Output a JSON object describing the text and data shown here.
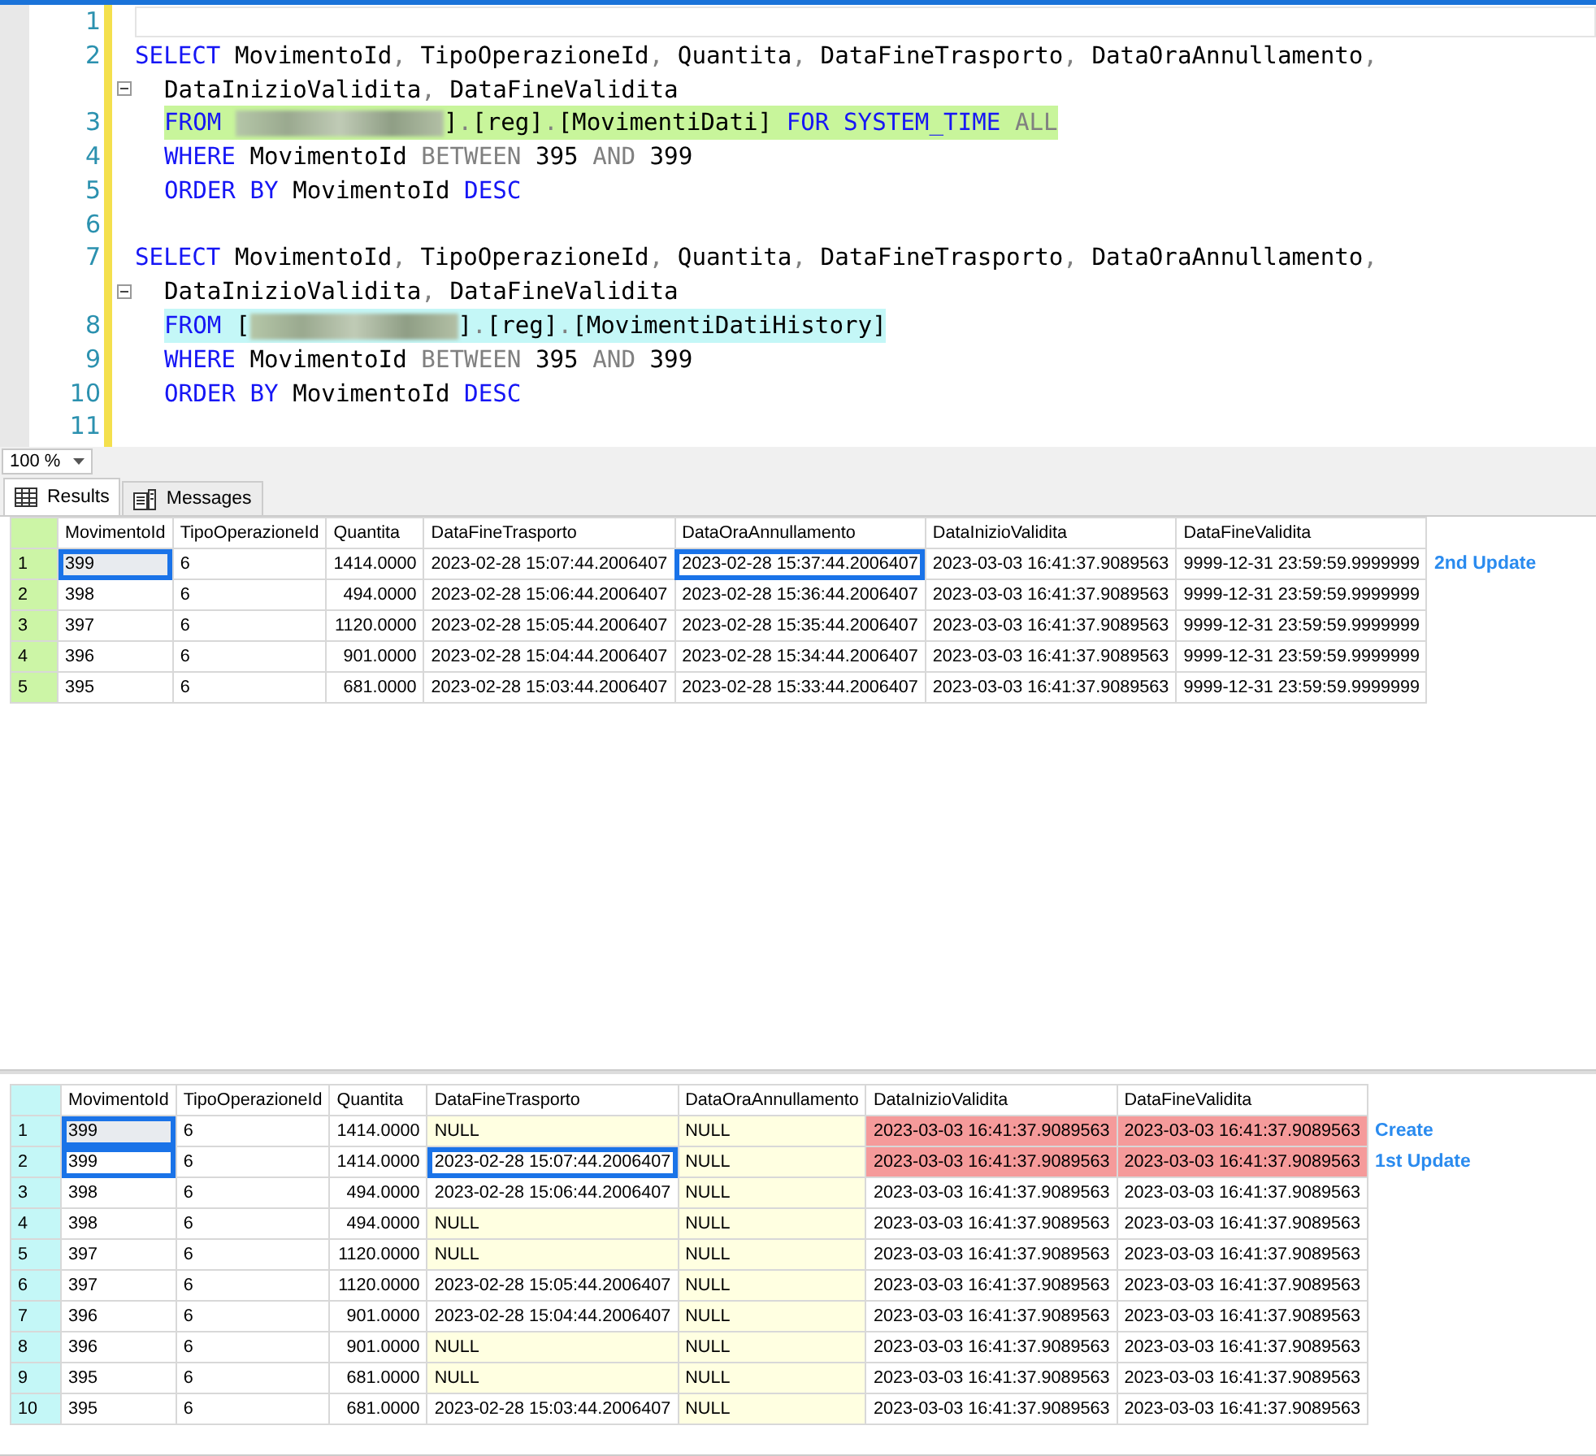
{
  "editor": {
    "lines": [
      {
        "number": "1",
        "current": true
      },
      {
        "number": "2",
        "tokens": [
          {
            "t": "SELECT",
            "kind": "kw"
          },
          {
            "t": " MovimentoId",
            "kind": "id"
          },
          {
            "t": ",",
            "kind": "gray"
          },
          {
            "t": " TipoOperazioneId",
            "kind": "id"
          },
          {
            "t": ",",
            "kind": "gray"
          },
          {
            "t": " Quantita",
            "kind": "id"
          },
          {
            "t": ",",
            "kind": "gray"
          },
          {
            "t": " DataFineTrasporto",
            "kind": "id"
          },
          {
            "t": ",",
            "kind": "gray"
          },
          {
            "t": " DataOraAnnullamento",
            "kind": "id"
          },
          {
            "t": ",",
            "kind": "gray"
          }
        ],
        "continuation": [
          {
            "t": "DataInizioValidita",
            "kind": "id"
          },
          {
            "t": ",",
            "kind": "gray"
          },
          {
            "t": " DataFineValidita",
            "kind": "id"
          }
        ]
      },
      {
        "number": "3",
        "indent": true,
        "color": "#c8f59b",
        "tokens": [
          {
            "t": "FROM ",
            "kind": "kw"
          },
          {
            "kind": "redacted"
          },
          {
            "t": "]",
            "kind": "id"
          },
          {
            "t": ".",
            "kind": "gray"
          },
          {
            "t": "[reg]",
            "kind": "id"
          },
          {
            "t": ".",
            "kind": "gray"
          },
          {
            "t": "[MovimentiDati]",
            "kind": "id"
          },
          {
            "t": " FOR SYSTEM_TIME ",
            "kind": "kw"
          },
          {
            "t": "ALL",
            "kind": "gray"
          }
        ]
      },
      {
        "number": "4",
        "indent": true,
        "tokens": [
          {
            "t": "WHERE",
            "kind": "kw"
          },
          {
            "t": " MovimentoId ",
            "kind": "id"
          },
          {
            "t": "BETWEEN",
            "kind": "gray"
          },
          {
            "t": " 395 ",
            "kind": "id"
          },
          {
            "t": "AND",
            "kind": "gray"
          },
          {
            "t": " 399",
            "kind": "id"
          }
        ]
      },
      {
        "number": "5",
        "indent": true,
        "tokens": [
          {
            "t": "ORDER BY",
            "kind": "kw"
          },
          {
            "t": " MovimentoId ",
            "kind": "id"
          },
          {
            "t": "DESC",
            "kind": "kw"
          }
        ]
      },
      {
        "number": "6"
      },
      {
        "number": "7",
        "tokens": [
          {
            "t": "SELECT",
            "kind": "kw"
          },
          {
            "t": " MovimentoId",
            "kind": "id"
          },
          {
            "t": ",",
            "kind": "gray"
          },
          {
            "t": " TipoOperazioneId",
            "kind": "id"
          },
          {
            "t": ",",
            "kind": "gray"
          },
          {
            "t": " Quantita",
            "kind": "id"
          },
          {
            "t": ",",
            "kind": "gray"
          },
          {
            "t": " DataFineTrasporto",
            "kind": "id"
          },
          {
            "t": ",",
            "kind": "gray"
          },
          {
            "t": " DataOraAnnullamento",
            "kind": "id"
          },
          {
            "t": ",",
            "kind": "gray"
          }
        ],
        "continuation": [
          {
            "t": "DataInizioValidita",
            "kind": "id"
          },
          {
            "t": ",",
            "kind": "gray"
          },
          {
            "t": " DataFineValidita",
            "kind": "id"
          }
        ]
      },
      {
        "number": "8",
        "indent": true,
        "color": "#c4f7f7",
        "tokens": [
          {
            "t": "FROM ",
            "kind": "kw"
          },
          {
            "t": "[",
            "kind": "id"
          },
          {
            "kind": "redacted"
          },
          {
            "t": "]",
            "kind": "id"
          },
          {
            "t": ".",
            "kind": "gray"
          },
          {
            "t": "[reg]",
            "kind": "id"
          },
          {
            "t": ".",
            "kind": "gray"
          },
          {
            "t": "[MovimentiDatiHistory]",
            "kind": "id"
          }
        ]
      },
      {
        "number": "9",
        "indent": true,
        "tokens": [
          {
            "t": "WHERE",
            "kind": "kw"
          },
          {
            "t": " MovimentoId ",
            "kind": "id"
          },
          {
            "t": "BETWEEN",
            "kind": "gray"
          },
          {
            "t": " 395 ",
            "kind": "id"
          },
          {
            "t": "AND",
            "kind": "gray"
          },
          {
            "t": " 399",
            "kind": "id"
          }
        ]
      },
      {
        "number": "10",
        "indent": true,
        "tokens": [
          {
            "t": "ORDER BY",
            "kind": "kw"
          },
          {
            "t": " MovimentoId ",
            "kind": "id"
          },
          {
            "t": "DESC",
            "kind": "kw"
          }
        ]
      },
      {
        "number": "11"
      }
    ]
  },
  "zoom": "100 %",
  "tabs": [
    {
      "label": "Results",
      "selected": true,
      "kind": "grid"
    },
    {
      "label": "Messages",
      "selected": false,
      "kind": "messages"
    }
  ],
  "grids": [
    {
      "color": "#ccf5a6",
      "columns": [
        {
          "label": "MovimentoId",
          "kind": "text"
        },
        {
          "label": "TipoOperazioneId",
          "kind": "text"
        },
        {
          "label": "Quantita",
          "kind": "number"
        },
        {
          "label": "DataFineTrasporto",
          "kind": "text"
        },
        {
          "label": "DataOraAnnullamento",
          "kind": "text"
        },
        {
          "label": "DataInizioValidita",
          "kind": "text"
        },
        {
          "label": "DataFineValidita",
          "kind": "text"
        }
      ],
      "rows": [
        {
          "number": "1",
          "note": "2nd Update",
          "cells": [
            {
              "v": "399",
              "kind": "current"
            },
            {
              "v": "6",
              "kind": "plain"
            },
            {
              "v": "1414.0000",
              "kind": "plain"
            },
            {
              "v": "2023-02-28 15:07:44.2006407",
              "kind": "plain"
            },
            {
              "v": "2023-02-28 15:37:44.2006407",
              "kind": "boxed"
            },
            {
              "v": "2023-03-03 16:41:37.9089563",
              "kind": "plain"
            },
            {
              "v": "9999-12-31 23:59:59.9999999",
              "kind": "plain"
            }
          ]
        },
        {
          "number": "2",
          "cells": [
            {
              "v": "398",
              "kind": "plain"
            },
            {
              "v": "6",
              "kind": "plain"
            },
            {
              "v": "494.0000",
              "kind": "plain"
            },
            {
              "v": "2023-02-28 15:06:44.2006407",
              "kind": "plain"
            },
            {
              "v": "2023-02-28 15:36:44.2006407",
              "kind": "plain"
            },
            {
              "v": "2023-03-03 16:41:37.9089563",
              "kind": "plain"
            },
            {
              "v": "9999-12-31 23:59:59.9999999",
              "kind": "plain"
            }
          ]
        },
        {
          "number": "3",
          "cells": [
            {
              "v": "397",
              "kind": "plain"
            },
            {
              "v": "6",
              "kind": "plain"
            },
            {
              "v": "1120.0000",
              "kind": "plain"
            },
            {
              "v": "2023-02-28 15:05:44.2006407",
              "kind": "plain"
            },
            {
              "v": "2023-02-28 15:35:44.2006407",
              "kind": "plain"
            },
            {
              "v": "2023-03-03 16:41:37.9089563",
              "kind": "plain"
            },
            {
              "v": "9999-12-31 23:59:59.9999999",
              "kind": "plain"
            }
          ]
        },
        {
          "number": "4",
          "cells": [
            {
              "v": "396",
              "kind": "plain"
            },
            {
              "v": "6",
              "kind": "plain"
            },
            {
              "v": "901.0000",
              "kind": "plain"
            },
            {
              "v": "2023-02-28 15:04:44.2006407",
              "kind": "plain"
            },
            {
              "v": "2023-02-28 15:34:44.2006407",
              "kind": "plain"
            },
            {
              "v": "2023-03-03 16:41:37.9089563",
              "kind": "plain"
            },
            {
              "v": "9999-12-31 23:59:59.9999999",
              "kind": "plain"
            }
          ]
        },
        {
          "number": "5",
          "cells": [
            {
              "v": "395",
              "kind": "plain"
            },
            {
              "v": "6",
              "kind": "plain"
            },
            {
              "v": "681.0000",
              "kind": "plain"
            },
            {
              "v": "2023-02-28 15:03:44.2006407",
              "kind": "plain"
            },
            {
              "v": "2023-02-28 15:33:44.2006407",
              "kind": "plain"
            },
            {
              "v": "2023-03-03 16:41:37.9089563",
              "kind": "plain"
            },
            {
              "v": "9999-12-31 23:59:59.9999999",
              "kind": "plain"
            }
          ]
        }
      ]
    },
    {
      "color": "#c4f7f7",
      "columns": [
        {
          "label": "MovimentoId",
          "kind": "text"
        },
        {
          "label": "TipoOperazioneId",
          "kind": "text"
        },
        {
          "label": "Quantita",
          "kind": "number"
        },
        {
          "label": "DataFineTrasporto",
          "kind": "text"
        },
        {
          "label": "DataOraAnnullamento",
          "kind": "text"
        },
        {
          "label": "DataInizioValidita",
          "kind": "text"
        },
        {
          "label": "DataFineValidita",
          "kind": "text"
        }
      ],
      "rows": [
        {
          "number": "1",
          "note": "Create",
          "cells": [
            {
              "v": "399",
              "kind": "current"
            },
            {
              "v": "6",
              "kind": "plain"
            },
            {
              "v": "1414.0000",
              "kind": "plain"
            },
            {
              "v": "NULL",
              "kind": "null"
            },
            {
              "v": "NULL",
              "kind": "null"
            },
            {
              "v": "2023-03-03 16:41:37.9089563",
              "kind": "pink"
            },
            {
              "v": "2023-03-03 16:41:37.9089563",
              "kind": "pink"
            }
          ]
        },
        {
          "number": "2",
          "note": "1st Update",
          "cells": [
            {
              "v": "399",
              "kind": "boxed"
            },
            {
              "v": "6",
              "kind": "plain"
            },
            {
              "v": "1414.0000",
              "kind": "plain"
            },
            {
              "v": "2023-02-28 15:07:44.2006407",
              "kind": "boxed"
            },
            {
              "v": "NULL",
              "kind": "null"
            },
            {
              "v": "2023-03-03 16:41:37.9089563",
              "kind": "pink"
            },
            {
              "v": "2023-03-03 16:41:37.9089563",
              "kind": "pink"
            }
          ]
        },
        {
          "number": "3",
          "cells": [
            {
              "v": "398",
              "kind": "plain"
            },
            {
              "v": "6",
              "kind": "plain"
            },
            {
              "v": "494.0000",
              "kind": "plain"
            },
            {
              "v": "2023-02-28 15:06:44.2006407",
              "kind": "plain"
            },
            {
              "v": "NULL",
              "kind": "null"
            },
            {
              "v": "2023-03-03 16:41:37.9089563",
              "kind": "plain"
            },
            {
              "v": "2023-03-03 16:41:37.9089563",
              "kind": "plain"
            }
          ]
        },
        {
          "number": "4",
          "cells": [
            {
              "v": "398",
              "kind": "plain"
            },
            {
              "v": "6",
              "kind": "plain"
            },
            {
              "v": "494.0000",
              "kind": "plain"
            },
            {
              "v": "NULL",
              "kind": "null"
            },
            {
              "v": "NULL",
              "kind": "null"
            },
            {
              "v": "2023-03-03 16:41:37.9089563",
              "kind": "plain"
            },
            {
              "v": "2023-03-03 16:41:37.9089563",
              "kind": "plain"
            }
          ]
        },
        {
          "number": "5",
          "cells": [
            {
              "v": "397",
              "kind": "plain"
            },
            {
              "v": "6",
              "kind": "plain"
            },
            {
              "v": "1120.0000",
              "kind": "plain"
            },
            {
              "v": "NULL",
              "kind": "null"
            },
            {
              "v": "NULL",
              "kind": "null"
            },
            {
              "v": "2023-03-03 16:41:37.9089563",
              "kind": "plain"
            },
            {
              "v": "2023-03-03 16:41:37.9089563",
              "kind": "plain"
            }
          ]
        },
        {
          "number": "6",
          "cells": [
            {
              "v": "397",
              "kind": "plain"
            },
            {
              "v": "6",
              "kind": "plain"
            },
            {
              "v": "1120.0000",
              "kind": "plain"
            },
            {
              "v": "2023-02-28 15:05:44.2006407",
              "kind": "plain"
            },
            {
              "v": "NULL",
              "kind": "null"
            },
            {
              "v": "2023-03-03 16:41:37.9089563",
              "kind": "plain"
            },
            {
              "v": "2023-03-03 16:41:37.9089563",
              "kind": "plain"
            }
          ]
        },
        {
          "number": "7",
          "cells": [
            {
              "v": "396",
              "kind": "plain"
            },
            {
              "v": "6",
              "kind": "plain"
            },
            {
              "v": "901.0000",
              "kind": "plain"
            },
            {
              "v": "2023-02-28 15:04:44.2006407",
              "kind": "plain"
            },
            {
              "v": "NULL",
              "kind": "null"
            },
            {
              "v": "2023-03-03 16:41:37.9089563",
              "kind": "plain"
            },
            {
              "v": "2023-03-03 16:41:37.9089563",
              "kind": "plain"
            }
          ]
        },
        {
          "number": "8",
          "cells": [
            {
              "v": "396",
              "kind": "plain"
            },
            {
              "v": "6",
              "kind": "plain"
            },
            {
              "v": "901.0000",
              "kind": "plain"
            },
            {
              "v": "NULL",
              "kind": "null"
            },
            {
              "v": "NULL",
              "kind": "null"
            },
            {
              "v": "2023-03-03 16:41:37.9089563",
              "kind": "plain"
            },
            {
              "v": "2023-03-03 16:41:37.9089563",
              "kind": "plain"
            }
          ]
        },
        {
          "number": "9",
          "cells": [
            {
              "v": "395",
              "kind": "plain"
            },
            {
              "v": "6",
              "kind": "plain"
            },
            {
              "v": "681.0000",
              "kind": "plain"
            },
            {
              "v": "NULL",
              "kind": "null"
            },
            {
              "v": "NULL",
              "kind": "null"
            },
            {
              "v": "2023-03-03 16:41:37.9089563",
              "kind": "plain"
            },
            {
              "v": "2023-03-03 16:41:37.9089563",
              "kind": "plain"
            }
          ]
        },
        {
          "number": "10",
          "cells": [
            {
              "v": "395",
              "kind": "plain"
            },
            {
              "v": "6",
              "kind": "plain"
            },
            {
              "v": "681.0000",
              "kind": "plain"
            },
            {
              "v": "2023-02-28 15:03:44.2006407",
              "kind": "plain"
            },
            {
              "v": "NULL",
              "kind": "null"
            },
            {
              "v": "2023-03-03 16:41:37.9089563",
              "kind": "plain"
            },
            {
              "v": "2023-03-03 16:41:37.9089563",
              "kind": "plain"
            }
          ]
        }
      ]
    }
  ]
}
